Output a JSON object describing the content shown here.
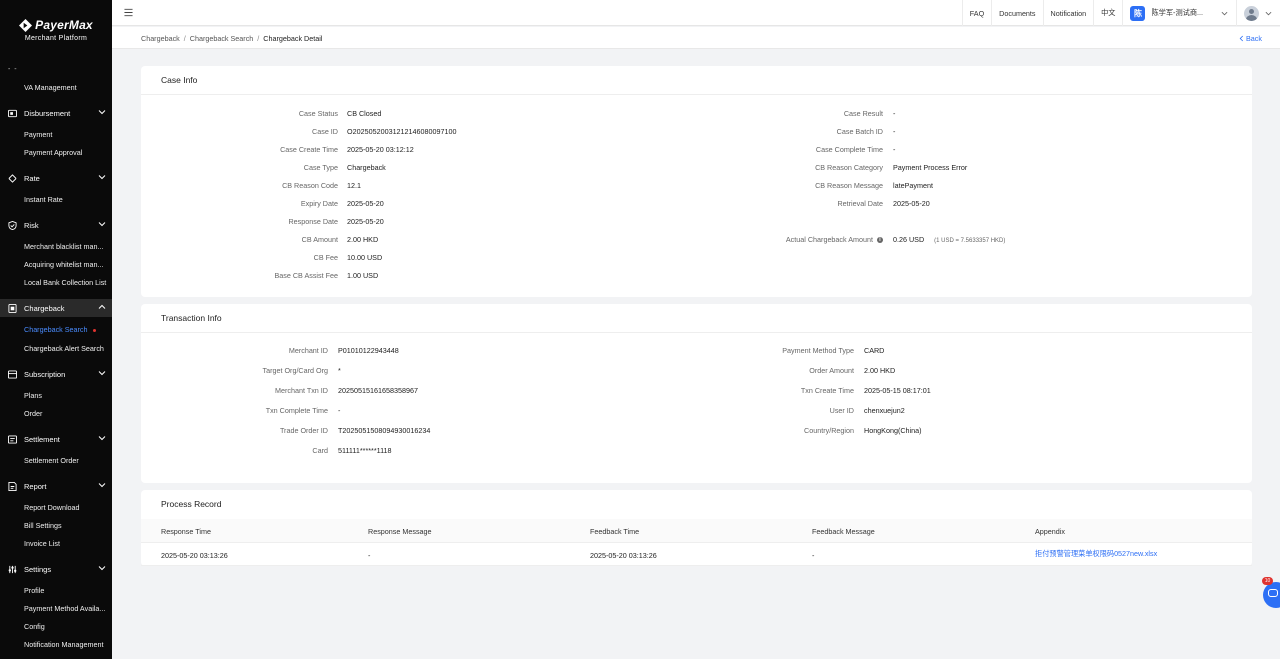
{
  "brand": {
    "name": "PayerMax",
    "subtitle": "Merchant  Platform",
    "dashes": "- -"
  },
  "sidebar": {
    "groups": [
      {
        "label": "",
        "items": [
          "VA Management"
        ]
      },
      {
        "label": "Disbursement",
        "icon": "disbursement-icon",
        "items": [
          "Payment",
          "Payment Approval"
        ]
      },
      {
        "label": "Rate",
        "icon": "rate-icon",
        "items": [
          "Instant Rate"
        ]
      },
      {
        "label": "Risk",
        "icon": "shield-icon",
        "items": [
          "Merchant blacklist man...",
          "Acquiring whitelist man...",
          "Local Bank Collection List"
        ]
      },
      {
        "label": "Chargeback",
        "icon": "chargeback-icon",
        "items": [
          "Chargeback Search",
          "Chargeback Alert Search"
        ]
      },
      {
        "label": "Subscription",
        "icon": "subscription-icon",
        "items": [
          "Plans",
          "Order"
        ]
      },
      {
        "label": "Settlement",
        "icon": "settlement-icon",
        "items": [
          "Settlement Order"
        ]
      },
      {
        "label": "Report",
        "icon": "report-icon",
        "items": [
          "Report Download",
          "Bill Settings",
          "Invoice List"
        ]
      },
      {
        "label": "Settings",
        "icon": "settings-icon",
        "items": [
          "Profile",
          "Payment Method Availa...",
          "Config",
          "Notification Management"
        ]
      }
    ],
    "active_item": "Chargeback Search"
  },
  "topbar": {
    "faq": "FAQ",
    "documents": "Documents",
    "notification": "Notification",
    "language": "中文",
    "user_initial": "陈",
    "user_name": "陈学军-测试商..."
  },
  "breadcrumb": {
    "items": [
      "Chargeback",
      "Chargeback Search",
      "Chargeback Detail"
    ],
    "back": "Back"
  },
  "case_info": {
    "title": "Case Info",
    "left": [
      {
        "label": "Case Status",
        "value": "CB Closed"
      },
      {
        "label": "Case ID",
        "value": "O20250520031212146080097100"
      },
      {
        "label": "Case Create Time",
        "value": "2025-05-20 03:12:12"
      },
      {
        "label": "Case Type",
        "value": "Chargeback"
      },
      {
        "label": "CB Reason Code",
        "value": "12.1"
      },
      {
        "label": "Expiry Date",
        "value": "2025-05-20"
      },
      {
        "label": "Response Date",
        "value": "2025-05-20"
      },
      {
        "label": "CB Amount",
        "value": "2.00 HKD"
      },
      {
        "label": "CB Fee",
        "value": "10.00 USD"
      },
      {
        "label": "Base CB Assist Fee",
        "value": "1.00 USD"
      }
    ],
    "right": [
      {
        "label": "Case Result",
        "value": "-"
      },
      {
        "label": "Case Batch ID",
        "value": "-"
      },
      {
        "label": "Case Complete Time",
        "value": "-"
      },
      {
        "label": "CB Reason Category",
        "value": "Payment Process Error"
      },
      {
        "label": "CB Reason Message",
        "value": "latePayment"
      },
      {
        "label": "Retrieval Date",
        "value": "2025-05-20"
      },
      {
        "label": "Actual Chargeback Amount",
        "value": "0.26 USD",
        "note": "(1 USD = 7.5633357 HKD)"
      }
    ]
  },
  "transaction_info": {
    "title": "Transaction Info",
    "left": [
      {
        "label": "Merchant ID",
        "value": "P01010122943448"
      },
      {
        "label": "Target Org/Card Org",
        "value": "*"
      },
      {
        "label": "Merchant Txn ID",
        "value": "20250515161658358967"
      },
      {
        "label": "Txn Complete Time",
        "value": "-"
      },
      {
        "label": "Trade Order ID",
        "value": "T2025051508094930016234"
      },
      {
        "label": "Card",
        "value": "511111******1118"
      }
    ],
    "right": [
      {
        "label": "Payment Method Type",
        "value": "CARD"
      },
      {
        "label": "Order Amount",
        "value": "2.00 HKD"
      },
      {
        "label": "Txn Create Time",
        "value": "2025-05-15 08:17:01"
      },
      {
        "label": "User ID",
        "value": "chenxuejun2"
      },
      {
        "label": "Country/Region",
        "value": "HongKong(China)"
      }
    ]
  },
  "process_record": {
    "title": "Process Record",
    "columns": [
      "Response Time",
      "Response Message",
      "Feedback Time",
      "Feedback Message",
      "Appendix"
    ],
    "rows": [
      [
        "2025-05-20 03:13:26",
        "-",
        "2025-05-20 03:13:26",
        "-",
        "拒付预警管理菜单权限码0527new.xlsx"
      ]
    ]
  },
  "float_badge": "10"
}
